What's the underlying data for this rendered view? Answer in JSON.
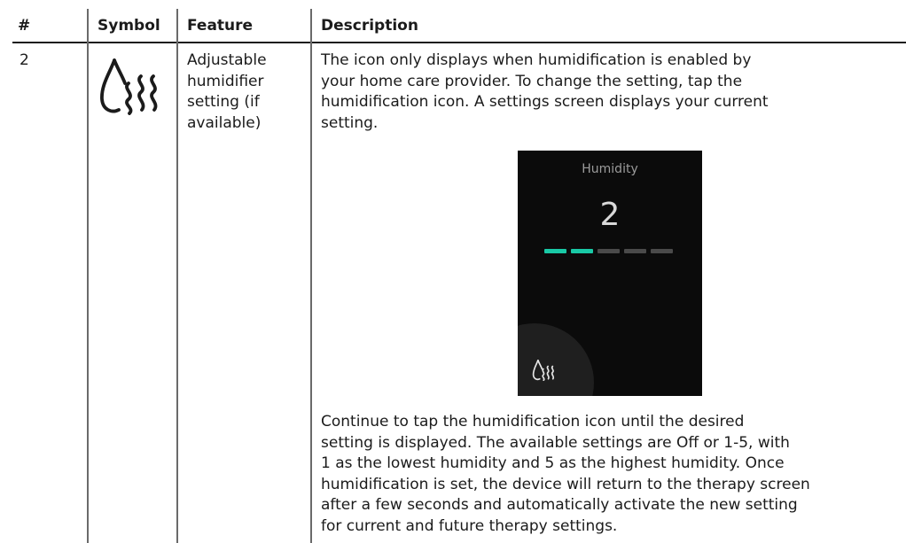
{
  "table": {
    "headers": {
      "number": "#",
      "symbol": "Symbol",
      "feature": "Feature",
      "description": "Description"
    },
    "rows": [
      {
        "number": "2",
        "symbol_icon": "humidifier-icon",
        "feature": [
          "Adjustable",
          "humidifier",
          "setting (if",
          "available)"
        ],
        "description_intro": [
          "The icon only displays when humidification is enabled by",
          "your home care provider. To change the setting, tap the",
          "humidification icon. A settings screen displays your current",
          "setting."
        ],
        "screen": {
          "title": "Humidity",
          "value": "2",
          "level": 2,
          "max_level": 5,
          "active_color": "#19c9a6",
          "inactive_color": "#4a4a4a",
          "icon": "humidifier-icon"
        },
        "description_outro": [
          "Continue to tap the humidification icon until the desired",
          "setting is displayed. The available settings are Off or 1-5, with",
          "1 as the lowest humidity and 5 as the highest humidity. Once",
          "humidification is set, the device will return to the therapy screen",
          "after a few seconds and automatically activate the new setting",
          "for current and future therapy settings."
        ]
      }
    ]
  }
}
